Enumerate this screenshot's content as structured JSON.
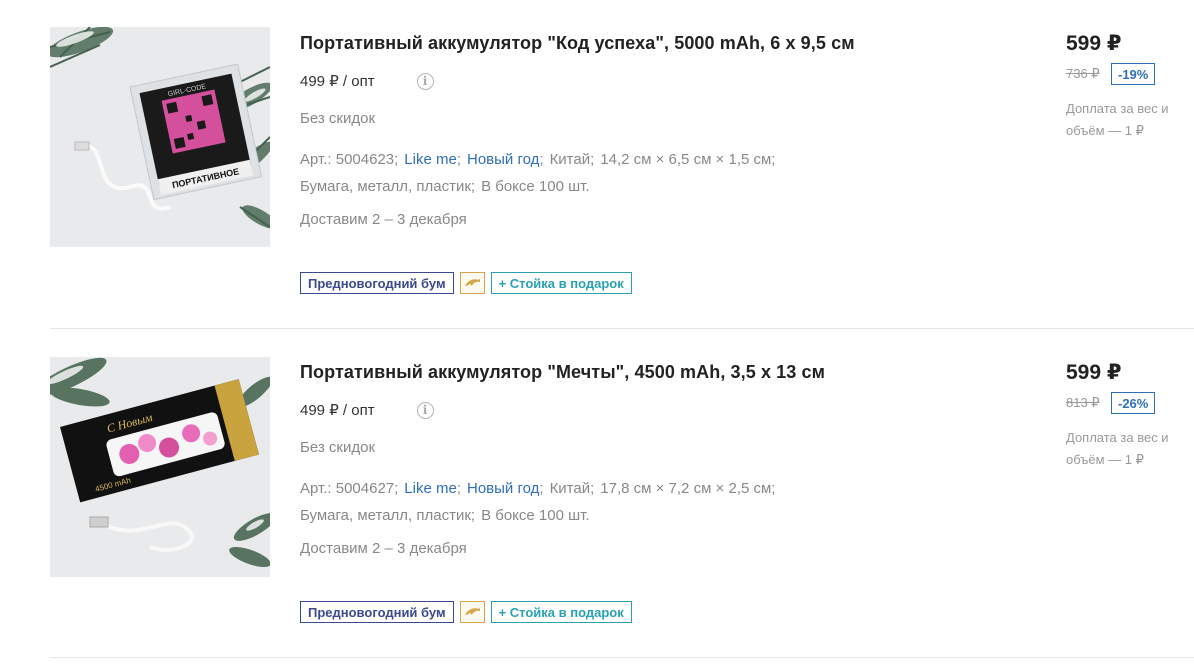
{
  "products": [
    {
      "title": "Портативный аккумулятор \"Код успеха\", 5000 mAh, 6 х 9,5 см",
      "wholesale_price": "499 ₽ / опт",
      "discount_note": "Без скидок",
      "article": "Арт.: 5004623;",
      "brand_link": "Like me",
      "category_link": "Новый год",
      "country": "Китай;",
      "dimensions": "14,2 см × 6,5 см × 1,5 см;",
      "materials": "Бумага, металл, пластик;",
      "box_qty": "В боксе 100 шт.",
      "delivery": "Доставим 2 – 3 декабря",
      "badge_promo": "Предновогодний бум",
      "badge_gift": "+ Стойка в подарок",
      "price": "599 ₽",
      "old_price": "736 ₽",
      "discount": "-19%",
      "surcharge": "Доплата за вес и объём — 1 ₽",
      "image_text": "ПОРТАТИВНОЕ",
      "image_logo": "GIRL-CODE"
    },
    {
      "title": "Портативный аккумулятор \"Мечты\", 4500 mAh, 3,5 х 13 см",
      "wholesale_price": "499 ₽ / опт",
      "discount_note": "Без скидок",
      "article": "Арт.: 5004627;",
      "brand_link": "Like me",
      "category_link": "Новый год",
      "country": "Китай;",
      "dimensions": "17,8 см × 7,2 см × 2,5 см;",
      "materials": "Бумага, металл, пластик;",
      "box_qty": "В боксе 100 шт.",
      "delivery": "Доставим 2 – 3 декабря",
      "badge_promo": "Предновогодний бум",
      "badge_gift": "+ Стойка в подарок",
      "price": "599 ₽",
      "old_price": "813 ₽",
      "discount": "-26%",
      "surcharge": "Доплата за вес и объём — 1 ₽",
      "image_text": "С Новым",
      "image_logo": "4500 mAh"
    }
  ],
  "colors": {
    "link": "#2f6fb7",
    "promo_badge": "#3b4a8c",
    "gift_badge": "#2aa1b3",
    "dolphin_badge": "#d5a64a"
  },
  "icons": {
    "info": "info-icon",
    "dolphin": "dolphin-icon"
  }
}
